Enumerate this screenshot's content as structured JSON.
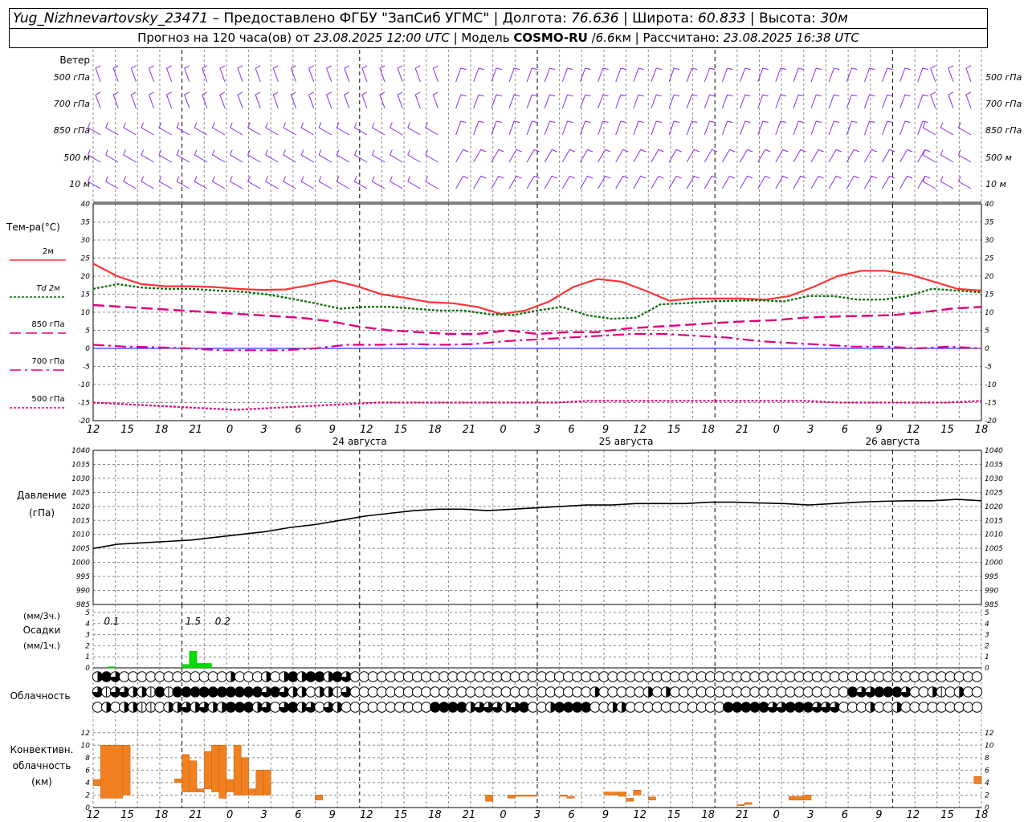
{
  "header": {
    "station": "Yug_Nizhnevartovsky_23471",
    "provided_by": "– Предоставлено ФГБУ \"ЗапСиб УГМС\" |",
    "lon_label": "Долгота:",
    "lon_value": "76.636",
    "lat_label": "| Широта:",
    "lat_value": "60.833",
    "alt_label": "| Высота:",
    "alt_value": "30м",
    "forecast_label": "Прогноз на 120 часа(ов) от",
    "forecast_time": "23.08.2025 12:00 UTC",
    "model_label": "| Модель",
    "model_name": "COSMO-RU",
    "model_sep": "/",
    "resolution": "6.6",
    "resolution_unit": "км |",
    "calc_label": "Рассчитано:",
    "calc_time": "23.08.2025 16:38 UTC"
  },
  "colors": {
    "t2m": "#ff3333",
    "td2m": "#006600",
    "t850": "#e0007a",
    "t700": "#e0007a",
    "t500": "#e0007a",
    "pressure": "#000000",
    "precip": "#00dd00",
    "convective": "#f08020",
    "wind": "#8a2be2",
    "grid": "#888888",
    "zero_line": "#0000ff"
  },
  "wind_panel": {
    "title": "Ветер",
    "levels": [
      "500 гПа",
      "700 гПа",
      "850 гПа",
      "500 м",
      "10 м"
    ]
  },
  "temp_panel": {
    "title": "Тем-ра(°C)",
    "legend": [
      {
        "label": "2м",
        "style": "solid"
      },
      {
        "label": "Td 2м",
        "style": "dotted"
      },
      {
        "label": "850 гПа",
        "style": "dashed"
      },
      {
        "label": "700 гПа",
        "style": "dashdot"
      },
      {
        "label": "500 гПа",
        "style": "fine"
      }
    ],
    "ticks": [
      "40",
      "35",
      "30",
      "25",
      "20",
      "15",
      "10",
      "5",
      "0",
      "-5",
      "-10",
      "-15",
      "-20"
    ]
  },
  "time_axis": {
    "hour_labels": [
      "12",
      "15",
      "18",
      "21",
      "0",
      "3",
      "6",
      "9",
      "12",
      "15",
      "18",
      "21",
      "0",
      "3",
      "6",
      "9",
      "12",
      "15",
      "18",
      "21",
      "0",
      "3",
      "6",
      "9",
      "12",
      "15",
      "18"
    ],
    "day_labels": [
      "24 августа",
      "25 августа",
      "26 августа"
    ]
  },
  "pressure_panel": {
    "title": "Давление",
    "unit": "(гПа)",
    "ticks": [
      "1040",
      "1035",
      "1030",
      "1025",
      "1020",
      "1015",
      "1010",
      "1005",
      "1000",
      "995",
      "990",
      "985"
    ]
  },
  "precip_panel": {
    "title_top": "(мм/3ч.)",
    "title_mid": "Осадки",
    "title_bot": "(мм/1ч.)",
    "ticks": [
      "5",
      "4",
      "3",
      "2",
      "1",
      "0"
    ],
    "totals": [
      "0.1",
      "1.5",
      "0.2"
    ]
  },
  "cloud_panel": {
    "title": "Облачность"
  },
  "conv_panel": {
    "title1": "Конвективн.",
    "title2": "облачность",
    "title3": "(км)",
    "ticks": [
      "12",
      "10",
      "8",
      "6",
      "4",
      "2",
      "0"
    ]
  },
  "chart_data": [
    {
      "type": "line",
      "name": "temperature",
      "x_hours": [
        0,
        3,
        6,
        9,
        12,
        15,
        18,
        21,
        24,
        27,
        30,
        33,
        36,
        39,
        42,
        45,
        48,
        51,
        54,
        57,
        60,
        63,
        66,
        69,
        72,
        75,
        78,
        81,
        84,
        87,
        90,
        93,
        96,
        99,
        102,
        105,
        108,
        111,
        114,
        117,
        120
      ],
      "ylim": [
        -20,
        40
      ],
      "series": [
        {
          "name": "2м",
          "values": [
            23.5,
            20,
            17.8,
            17.2,
            17.2,
            17,
            16.5,
            16.2,
            16.3,
            17.5,
            18.8,
            17.2,
            15,
            14,
            12.8,
            12.5,
            11.5,
            9.5,
            10.5,
            13,
            17,
            19.2,
            18.5,
            16,
            13.2,
            13.8,
            13.8,
            13.8,
            13.5,
            14.5,
            17,
            20,
            21.5,
            21.5,
            20.5,
            18.5,
            16.5,
            16
          ]
        },
        {
          "name": "Td 2м",
          "values": [
            16.5,
            17.8,
            16.8,
            16.5,
            16.5,
            16,
            15.7,
            15,
            13.8,
            12.5,
            11,
            11.5,
            11.5,
            11,
            10.5,
            10.5,
            9.5,
            9.2,
            10.5,
            11.5,
            9.2,
            8.2,
            8.5,
            12.2,
            12.5,
            13,
            13.2,
            13.3,
            13,
            14.5,
            14.5,
            13.5,
            13.5,
            14.5,
            16.5,
            16,
            15.5
          ]
        },
        {
          "name": "850 гПа",
          "values": [
            12,
            11.5,
            11,
            10.5,
            10,
            9.5,
            9,
            8.5,
            7.5,
            6,
            5,
            4.5,
            4,
            4,
            5,
            4,
            4.5,
            4.5,
            5.5,
            6,
            6.5,
            7,
            7.5,
            7.8,
            8.5,
            8.8,
            9,
            9.2,
            10,
            11,
            11.5
          ]
        },
        {
          "name": "700 гПа",
          "values": [
            1,
            0.5,
            0.3,
            0,
            -0.5,
            -0.5,
            -0.5,
            0,
            1,
            1,
            1.2,
            1,
            1.2,
            2,
            2.5,
            3,
            3.5,
            4,
            4,
            3.5,
            3,
            2,
            1.5,
            1,
            0.5,
            0.5,
            0,
            0.5,
            0
          ]
        },
        {
          "name": "500 гПа",
          "values": [
            -15,
            -15.5,
            -16,
            -16.5,
            -17,
            -16.5,
            -16,
            -15.5,
            -15,
            -15,
            -15,
            -15,
            -15,
            -15,
            -14.5,
            -14.5,
            -14.5,
            -14.5,
            -14.5,
            -14.5,
            -14.5,
            -15,
            -15,
            -15,
            -15,
            -14.5
          ]
        }
      ]
    },
    {
      "type": "line",
      "name": "pressure",
      "x_hours": [
        0,
        3,
        6,
        9,
        12,
        15,
        18,
        21,
        24,
        27,
        30,
        33,
        36,
        39,
        42,
        45,
        48,
        51,
        54,
        57,
        60,
        63,
        66,
        69,
        72,
        75,
        78,
        81,
        84,
        87,
        90,
        93,
        96,
        99,
        102,
        105,
        108,
        111,
        114,
        117,
        120
      ],
      "ylim": [
        985,
        1040
      ],
      "values": [
        1005,
        1006.5,
        1007,
        1007.5,
        1008,
        1009,
        1010,
        1011,
        1012.5,
        1013.5,
        1015,
        1016.5,
        1017.5,
        1018.5,
        1019,
        1019,
        1018.5,
        1019,
        1019.5,
        1020,
        1020.5,
        1020.5,
        1021,
        1021,
        1021,
        1021.5,
        1021.5,
        1021.2,
        1021,
        1020.5,
        1021,
        1021.5,
        1021.8,
        1022,
        1022,
        1022.5,
        1022
      ]
    },
    {
      "type": "bar",
      "name": "precipitation_1h",
      "ylim": [
        0,
        5
      ],
      "bars": [
        {
          "start_h": 2,
          "end_h": 3,
          "value": 0.1
        },
        {
          "start_h": 12,
          "end_h": 13,
          "value": 0.3
        },
        {
          "start_h": 13,
          "end_h": 14,
          "value": 1.5
        },
        {
          "start_h": 14,
          "end_h": 15,
          "value": 0.4
        },
        {
          "start_h": 15,
          "end_h": 16,
          "value": 0.4
        }
      ]
    },
    {
      "type": "bar",
      "name": "convective_cloud_km",
      "ylim": [
        0,
        13
      ],
      "bars": [
        {
          "start_h": 0,
          "end_h": 1,
          "base": 3.5,
          "top": 4.5
        },
        {
          "start_h": 1,
          "end_h": 4,
          "base": 1.5,
          "top": 10
        },
        {
          "start_h": 4,
          "end_h": 5,
          "base": 2.0,
          "top": 10
        },
        {
          "start_h": 11,
          "end_h": 12,
          "base": 4.0,
          "top": 4.6
        },
        {
          "start_h": 12,
          "end_h": 13,
          "base": 2.5,
          "top": 8.5
        },
        {
          "start_h": 13,
          "end_h": 14,
          "base": 2.5,
          "top": 7.5
        },
        {
          "start_h": 14,
          "end_h": 15,
          "base": 2.5,
          "top": 3.0
        },
        {
          "start_h": 15,
          "end_h": 16,
          "base": 3.0,
          "top": 9.0
        },
        {
          "start_h": 16,
          "end_h": 17,
          "base": 2.5,
          "top": 10
        },
        {
          "start_h": 17,
          "end_h": 18,
          "base": 1.5,
          "top": 10
        },
        {
          "start_h": 18,
          "end_h": 19,
          "base": 2.5,
          "top": 4.5
        },
        {
          "start_h": 19,
          "end_h": 20,
          "base": 2.0,
          "top": 10
        },
        {
          "start_h": 20,
          "end_h": 21,
          "base": 2.0,
          "top": 8.0
        },
        {
          "start_h": 21,
          "end_h": 22,
          "base": 2.0,
          "top": 3.0
        },
        {
          "start_h": 22,
          "end_h": 23,
          "base": 2.0,
          "top": 6.0
        },
        {
          "start_h": 23,
          "end_h": 24,
          "base": 2.0,
          "top": 6.0
        },
        {
          "start_h": 30,
          "end_h": 31,
          "base": 1.2,
          "top": 2.0
        },
        {
          "start_h": 53,
          "end_h": 54,
          "base": 1.0,
          "top": 2.0
        },
        {
          "start_h": 56,
          "end_h": 57,
          "base": 1.5,
          "top": 2.0
        },
        {
          "start_h": 57,
          "end_h": 60,
          "base": 1.8,
          "top": 2.0
        },
        {
          "start_h": 63,
          "end_h": 64,
          "base": 1.8,
          "top": 2.0
        },
        {
          "start_h": 64,
          "end_h": 65,
          "base": 1.5,
          "top": 1.8
        },
        {
          "start_h": 69,
          "end_h": 71,
          "base": 2.0,
          "top": 2.5
        },
        {
          "start_h": 71,
          "end_h": 72,
          "base": 1.8,
          "top": 2.5
        },
        {
          "start_h": 72,
          "end_h": 73,
          "base": 1.0,
          "top": 1.5
        },
        {
          "start_h": 73,
          "end_h": 74,
          "base": 2.0,
          "top": 2.8
        },
        {
          "start_h": 75,
          "end_h": 76,
          "base": 1.2,
          "top": 1.7
        },
        {
          "start_h": 87,
          "end_h": 88,
          "base": 0.3,
          "top": 0.5
        },
        {
          "start_h": 88,
          "end_h": 89,
          "base": 0.5,
          "top": 0.8
        },
        {
          "start_h": 94,
          "end_h": 96,
          "base": 1.2,
          "top": 1.8
        },
        {
          "start_h": 96,
          "end_h": 97,
          "base": 1.2,
          "top": 2.0
        },
        {
          "start_h": 119,
          "end_h": 120,
          "base": 3.8,
          "top": 5.0
        }
      ]
    },
    {
      "type": "table",
      "name": "cloud_cover_eighths",
      "rows": [
        {
          "layer": "upper",
          "values": [
            4,
            8,
            6,
            0,
            0,
            0,
            0,
            0,
            0,
            0,
            0,
            0,
            0,
            0,
            0,
            4,
            0,
            0,
            0,
            4,
            0,
            4,
            8,
            4,
            8,
            8,
            4,
            8,
            6,
            0,
            0,
            0,
            0,
            0,
            0,
            0,
            0,
            0,
            0,
            0,
            0,
            0,
            0,
            0,
            0,
            0,
            0,
            0,
            0,
            0,
            0,
            0,
            0,
            0,
            0,
            0,
            0,
            0,
            0,
            0,
            0,
            0,
            0,
            0,
            0,
            0,
            0,
            0,
            0,
            0,
            0,
            0,
            0,
            0,
            0,
            0,
            0,
            0,
            0,
            0,
            0,
            0,
            0,
            0,
            0,
            0,
            0,
            0,
            0,
            0,
            0,
            0,
            0,
            0,
            0,
            0,
            0,
            0,
            0,
            0
          ]
        },
        {
          "layer": "middle",
          "values": [
            6,
            2,
            6,
            6,
            4,
            4,
            2,
            8,
            2,
            8,
            8,
            8,
            8,
            8,
            8,
            8,
            8,
            8,
            8,
            6,
            8,
            6,
            4,
            4,
            0,
            4,
            4,
            2,
            6,
            0,
            0,
            0,
            0,
            0,
            0,
            0,
            0,
            0,
            0,
            0,
            0,
            0,
            0,
            0,
            0,
            0,
            0,
            0,
            0,
            0,
            0,
            0,
            0,
            0,
            0,
            0,
            4,
            0,
            0,
            0,
            0,
            0,
            4,
            0,
            4,
            0,
            0,
            0,
            0,
            0,
            0,
            0,
            0,
            0,
            0,
            0,
            0,
            0,
            0,
            0,
            0,
            0,
            0,
            0,
            0,
            8,
            6,
            6,
            8,
            8,
            8,
            6,
            0,
            0,
            4,
            2,
            0,
            4,
            0,
            0
          ]
        },
        {
          "layer": "lower",
          "values": [
            0,
            4,
            0,
            4,
            4,
            2,
            2,
            0,
            4,
            4,
            6,
            4,
            6,
            4,
            4,
            8,
            8,
            8,
            4,
            6,
            0,
            6,
            8,
            4,
            6,
            0,
            6,
            4,
            0,
            0,
            0,
            0,
            0,
            0,
            0,
            0,
            0,
            0,
            8,
            8,
            8,
            8,
            4,
            6,
            6,
            6,
            4,
            6,
            8,
            0,
            0,
            4,
            8,
            8,
            8,
            8,
            0,
            0,
            4,
            4,
            0,
            0,
            0,
            0,
            0,
            0,
            0,
            0,
            0,
            0,
            0,
            8,
            8,
            8,
            8,
            8,
            6,
            6,
            8,
            8,
            8,
            6,
            6,
            6,
            0,
            0,
            0,
            4,
            0,
            0,
            4,
            0,
            0,
            0,
            0,
            0,
            0,
            0,
            0,
            0
          ]
        }
      ]
    }
  ]
}
